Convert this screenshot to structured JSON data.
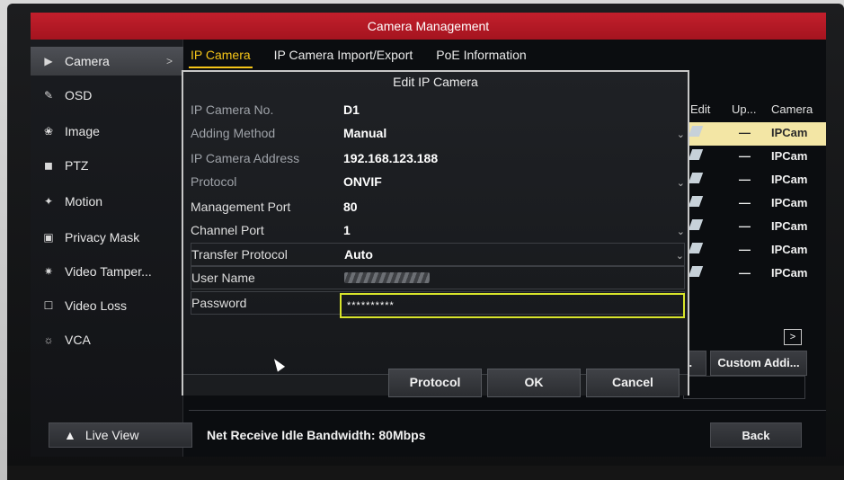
{
  "window": {
    "title": "Camera Management"
  },
  "sidebar": {
    "items": [
      {
        "label": "Camera",
        "icon": "camera-icon",
        "active": true
      },
      {
        "label": "OSD",
        "icon": "osd-icon"
      },
      {
        "label": "Image",
        "icon": "image-icon"
      },
      {
        "label": "PTZ",
        "icon": "ptz-icon"
      },
      {
        "label": "Motion",
        "icon": "motion-icon"
      },
      {
        "label": "Privacy Mask",
        "icon": "privacy-mask-icon"
      },
      {
        "label": "Video Tamper...",
        "icon": "video-tamper-icon"
      },
      {
        "label": "Video Loss",
        "icon": "video-loss-icon"
      },
      {
        "label": "VCA",
        "icon": "vca-icon"
      }
    ],
    "live_view": "Live View"
  },
  "tabs": [
    {
      "label": "IP Camera",
      "active": true
    },
    {
      "label": "IP Camera Import/Export"
    },
    {
      "label": "PoE Information"
    }
  ],
  "camera_table": {
    "headers": [
      "Edit",
      "Up...",
      "Camera"
    ],
    "rows": [
      {
        "upgrade": "—",
        "camera": "IPCam",
        "selected": true
      },
      {
        "upgrade": "—",
        "camera": "IPCam"
      },
      {
        "upgrade": "—",
        "camera": "IPCam"
      },
      {
        "upgrade": "—",
        "camera": "IPCam"
      },
      {
        "upgrade": "—",
        "camera": "IPCam"
      },
      {
        "upgrade": "—",
        "camera": "IPCam"
      },
      {
        "upgrade": "—",
        "camera": "IPCam"
      }
    ],
    "scroll_right": ">",
    "partial_button": "A...",
    "custom_add_button": "Custom Addi..."
  },
  "dialog": {
    "title": "Edit IP Camera",
    "fields": {
      "camera_no": {
        "label": "IP Camera No.",
        "value": "D1"
      },
      "adding_method": {
        "label": "Adding Method",
        "value": "Manual"
      },
      "address": {
        "label": "IP Camera Address",
        "value": "192.168.123.188"
      },
      "protocol": {
        "label": "Protocol",
        "value": "ONVIF"
      },
      "management_port": {
        "label": "Management Port",
        "value": "80"
      },
      "channel_port": {
        "label": "Channel Port",
        "value": "1"
      },
      "transfer_protocol": {
        "label": "Transfer Protocol",
        "value": "Auto"
      },
      "user_name": {
        "label": "User Name"
      },
      "password": {
        "label": "Password",
        "value": "**********"
      }
    },
    "buttons": {
      "protocol": "Protocol",
      "ok": "OK",
      "cancel": "Cancel"
    }
  },
  "status": {
    "bandwidth": "Net Receive Idle Bandwidth: 80Mbps"
  },
  "footer": {
    "back": "Back"
  },
  "colors": {
    "title_red": "#b81a26",
    "active_tab": "#f5c518",
    "focus_border": "#d8e42b"
  }
}
